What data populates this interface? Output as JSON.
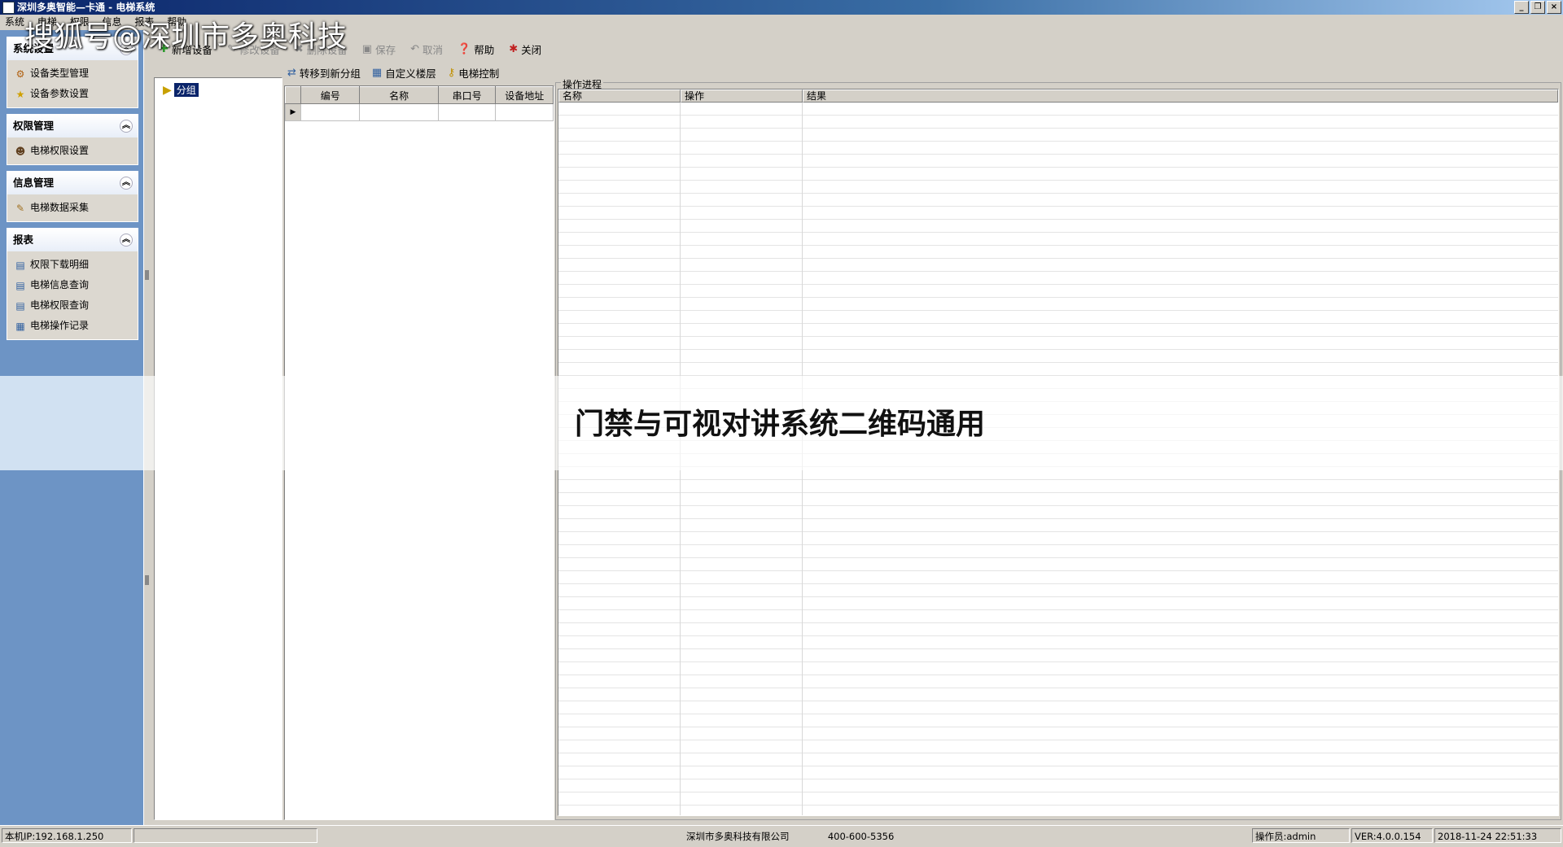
{
  "window": {
    "title": "深圳多奥智能—卡通 - 电梯系统"
  },
  "menubar": {
    "items": [
      "系统",
      "电梯",
      "权限",
      "信息",
      "报表",
      "帮助"
    ]
  },
  "watermark": "搜狐号@深圳市多奥科技",
  "sidebar": {
    "groups": [
      {
        "title": "系统设置",
        "items": [
          "设备类型管理",
          "设备参数设置"
        ]
      },
      {
        "title": "权限管理",
        "items": [
          "电梯权限设置"
        ]
      },
      {
        "title": "信息管理",
        "items": [
          "电梯数据采集"
        ]
      },
      {
        "title": "报表",
        "items": [
          "权限下载明细",
          "电梯信息查询",
          "电梯权限查询",
          "电梯操作记录"
        ]
      }
    ]
  },
  "toolbar": {
    "add": "新增设备",
    "edit": "修改设备",
    "delete": "删除设备",
    "save": "保存",
    "cancel": "取消",
    "help": "帮助",
    "close": "关闭"
  },
  "tree": {
    "root": "分组"
  },
  "device_toolbar": {
    "move": "转移到新分组",
    "custom_floor": "自定义楼层",
    "control": "电梯控制"
  },
  "device_grid": {
    "columns": [
      "编号",
      "名称",
      "串口号",
      "设备地址"
    ]
  },
  "op_pane": {
    "title": "操作进程",
    "columns": [
      "名称",
      "操作",
      "结果"
    ]
  },
  "overlay_caption": "门禁与可视对讲系统二维码通用",
  "statusbar": {
    "ip": "本机IP:192.168.1.250",
    "company": "深圳市多奥科技有限公司",
    "phone": "400-600-5356",
    "operator": "操作员:admin",
    "version": "VER:4.0.0.154",
    "datetime": "2018-11-24 22:51:33"
  }
}
